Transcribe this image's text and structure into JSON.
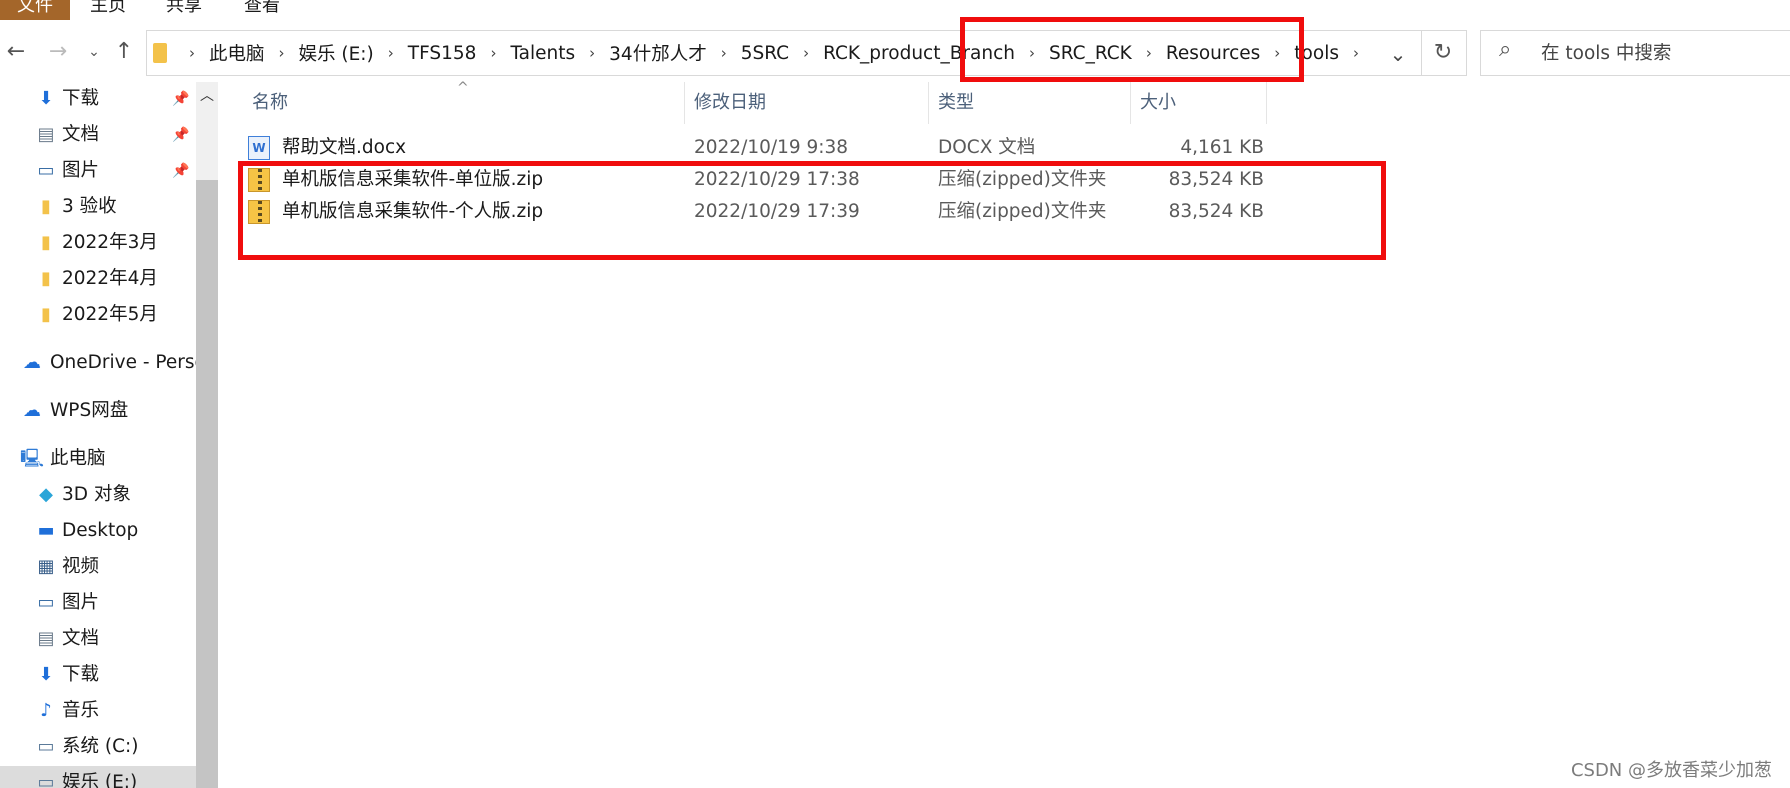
{
  "ribbon": {
    "tabs": [
      "文件",
      "主页",
      "共享",
      "查看"
    ]
  },
  "nav": {
    "breadcrumb": [
      "此电脑",
      "娱乐 (E:)",
      "TFS158",
      "Talents",
      "34什邡人才",
      "5SRC",
      "RCK_product_Branch",
      "SRC_RCK",
      "Resources",
      "tools"
    ],
    "search_placeholder": "在 tools 中搜索"
  },
  "sidebar": {
    "quick": [
      {
        "label": "下载",
        "icon": "download-arrow-icon",
        "pinned": true
      },
      {
        "label": "文档",
        "icon": "document-icon",
        "pinned": true
      },
      {
        "label": "图片",
        "icon": "picture-icon",
        "pinned": true
      },
      {
        "label": "3 验收",
        "icon": "folder-icon"
      },
      {
        "label": "2022年3月",
        "icon": "folder-icon"
      },
      {
        "label": "2022年4月",
        "icon": "folder-icon"
      },
      {
        "label": "2022年5月",
        "icon": "folder-icon"
      }
    ],
    "onedrive": "OneDrive - Perso",
    "wps": "WPS网盘",
    "this_pc": "此电脑",
    "pc_items": [
      {
        "label": "3D 对象",
        "icon": "cube-icon"
      },
      {
        "label": "Desktop",
        "icon": "desktop-icon"
      },
      {
        "label": "视频",
        "icon": "video-icon"
      },
      {
        "label": "图片",
        "icon": "picture-icon"
      },
      {
        "label": "文档",
        "icon": "document-icon"
      },
      {
        "label": "下载",
        "icon": "download-arrow-icon"
      },
      {
        "label": "音乐",
        "icon": "music-icon"
      },
      {
        "label": "系统 (C:)",
        "icon": "drive-icon"
      },
      {
        "label": "娱乐 (E:)",
        "icon": "drive-icon"
      }
    ]
  },
  "columns": {
    "name": "名称",
    "date": "修改日期",
    "type": "类型",
    "size": "大小"
  },
  "files": [
    {
      "name": "帮助文档.docx",
      "date": "2022/10/19 9:38",
      "type": "DOCX 文档",
      "size": "4,161 KB",
      "icon": "word-doc-icon"
    },
    {
      "name": "单机版信息采集软件-单位版.zip",
      "date": "2022/10/29 17:38",
      "type": "压缩(zipped)文件夹",
      "size": "83,524 KB",
      "icon": "zip-folder-icon"
    },
    {
      "name": "单机版信息采集软件-个人版.zip",
      "date": "2022/10/29 17:39",
      "type": "压缩(zipped)文件夹",
      "size": "83,524 KB",
      "icon": "zip-folder-icon"
    }
  ],
  "colors": {
    "highlight_box": "#f00d0d",
    "file_tab": "#a4662a",
    "header_text": "#4c607a"
  },
  "watermark": "CSDN @多放香菜少加葱"
}
